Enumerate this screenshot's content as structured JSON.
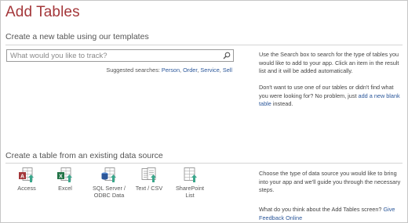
{
  "page": {
    "title": "Add Tables"
  },
  "templates_section": {
    "heading": "Create a new table using our templates",
    "search_placeholder": "What would you like to track?",
    "suggested_prefix": "Suggested searches: ",
    "suggestions": [
      "Person",
      "Order",
      "Service",
      "Sell"
    ],
    "help_text": "Use the Search box to search for the type of tables you would like to add to your app. Click an item in the result list and it will be added automatically.",
    "blank_text_before": "Don't want to use one of our tables or didn't find what you were looking for? No problem, just ",
    "blank_link": "add a new blank table",
    "blank_text_after": " instead."
  },
  "datasource_section": {
    "heading": "Create a table from an existing data source",
    "sources": [
      {
        "label": "Access",
        "icon": "access-icon",
        "color": "#a4373a"
      },
      {
        "label": "Excel",
        "icon": "excel-icon",
        "color": "#217346"
      },
      {
        "label": "SQL Server / ODBC Data",
        "icon": "sql-server-icon",
        "color": "#2b579a"
      },
      {
        "label": "Text / CSV",
        "icon": "text-csv-icon",
        "color": "#666666"
      },
      {
        "label": "SharePoint List",
        "icon": "sharepoint-icon",
        "color": "#0072c6"
      }
    ],
    "help_text": "Choose the type of data source you would like to bring into your app and we'll guide you through the necessary steps.",
    "feedback_before": "What do you think about the Add Tables screen? ",
    "feedback_link": "Give Feedback Online"
  },
  "colors": {
    "title": "#a4373a",
    "link": "#2b579a",
    "arrow": "#3aa68b"
  }
}
